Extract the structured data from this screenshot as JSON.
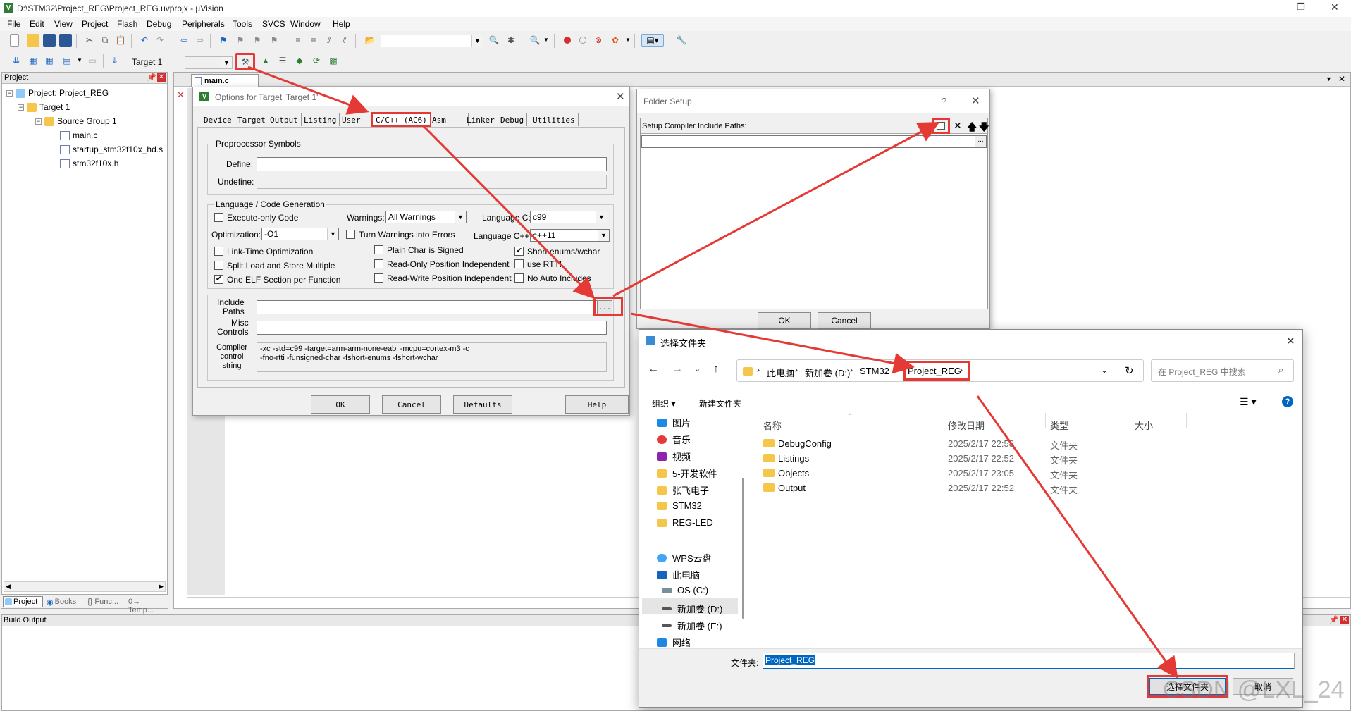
{
  "window": {
    "title": "D:\\STM32\\Project_REG\\Project_REG.uvprojx - µVision",
    "controls": [
      "—",
      "❐",
      "✕"
    ]
  },
  "menu": [
    "File",
    "Edit",
    "View",
    "Project",
    "Flash",
    "Debug",
    "Peripherals",
    "Tools",
    "SVCS",
    "Window",
    "Help"
  ],
  "toolbar": {
    "target_label": "Target 1"
  },
  "project_panel": {
    "title": "Project",
    "root": "Project: Project_REG",
    "target": "Target 1",
    "group": "Source Group 1",
    "files": [
      "main.c",
      "startup_stm32f10x_hd.s",
      "stm32f10x.h"
    ],
    "tabs": [
      "Project",
      "Books",
      "{} Func...",
      "0→ Temp..."
    ]
  },
  "editor": {
    "tab": "main.c"
  },
  "build_output": {
    "title": "Build Output"
  },
  "options_dialog": {
    "title": "Options for Target 'Target 1'",
    "tabs": [
      "Device",
      "Target",
      "Output",
      "Listing",
      "User",
      "C/C++ (AC6)",
      "Asm",
      "Linker",
      "Debug",
      "Utilities"
    ],
    "active_tab": "C/C++ (AC6)",
    "preprocessor": {
      "title": "Preprocessor Symbols",
      "define_label": "Define:",
      "define_value": "",
      "undefine_label": "Undefine:"
    },
    "lang": {
      "title": "Language / Code Generation",
      "execute_only": "Execute-only Code",
      "warnings_label": "Warnings:",
      "warnings_value": "All Warnings",
      "language_c_label": "Language C:",
      "language_c_value": "c99",
      "optimization_label": "Optimization:",
      "optimization_value": "-O1",
      "turn_warnings": "Turn Warnings into Errors",
      "language_cpp_label": "Language C++:",
      "language_cpp_value": "c++11",
      "link_time": "Link-Time Optimization",
      "plain_char": "Plain Char is Signed",
      "short_enums": "Short enums/wchar",
      "split_load": "Split Load and Store Multiple",
      "ro_pi": "Read-Only Position Independent",
      "use_rtti": "use RTTI",
      "one_elf": "One ELF Section per Function",
      "rw_pi": "Read-Write Position Independent",
      "no_auto": "No Auto Includes"
    },
    "include_label": "Include\nPaths",
    "misc_label": "Misc\nControls",
    "compiler_label": "Compiler\ncontrol\nstring",
    "compiler_string": "-xc -std=c99 -target=arm-arm-none-eabi -mcpu=cortex-m3 -c\n-fno-rtti -funsigned-char -fshort-enums -fshort-wchar",
    "buttons": [
      "OK",
      "Cancel",
      "Defaults",
      "Help"
    ],
    "browse": "..."
  },
  "folder_setup": {
    "title": "Folder Setup",
    "help": "?",
    "header": "Setup Compiler Include Paths:",
    "browse": "...",
    "ok": "OK",
    "cancel": "Cancel"
  },
  "select_folder": {
    "title": "选择文件夹",
    "breadcrumb": [
      "此电脑",
      "新加卷 (D:)",
      "STM32",
      "Project_REG"
    ],
    "search_placeholder": "在 Project_REG 中搜索",
    "organize": "组织 ▾",
    "new_folder": "新建文件夹",
    "nav_items": [
      "图片",
      "音乐",
      "视频",
      "5-开发软件",
      "张飞电子",
      "STM32",
      "REG-LED",
      "WPS云盘",
      "此电脑",
      "OS (C:)",
      "新加卷 (D:)",
      "新加卷 (E:)",
      "网络"
    ],
    "columns": [
      "名称",
      "修改日期",
      "类型",
      "大小"
    ],
    "rows": [
      {
        "name": "DebugConfig",
        "date": "2025/2/17 22:58",
        "type": "文件夹"
      },
      {
        "name": "Listings",
        "date": "2025/2/17 22:52",
        "type": "文件夹"
      },
      {
        "name": "Objects",
        "date": "2025/2/17 23:05",
        "type": "文件夹"
      },
      {
        "name": "Output",
        "date": "2025/2/17 22:52",
        "type": "文件夹"
      }
    ],
    "folder_label": "文件夹:",
    "folder_value": "Project_REG",
    "select_button": "选择文件夹",
    "cancel_button": "取消"
  },
  "watermark": "CSDN @LXL_24",
  "colors": {
    "annotation_red": "#e53935",
    "accent_blue": "#0067c0"
  }
}
